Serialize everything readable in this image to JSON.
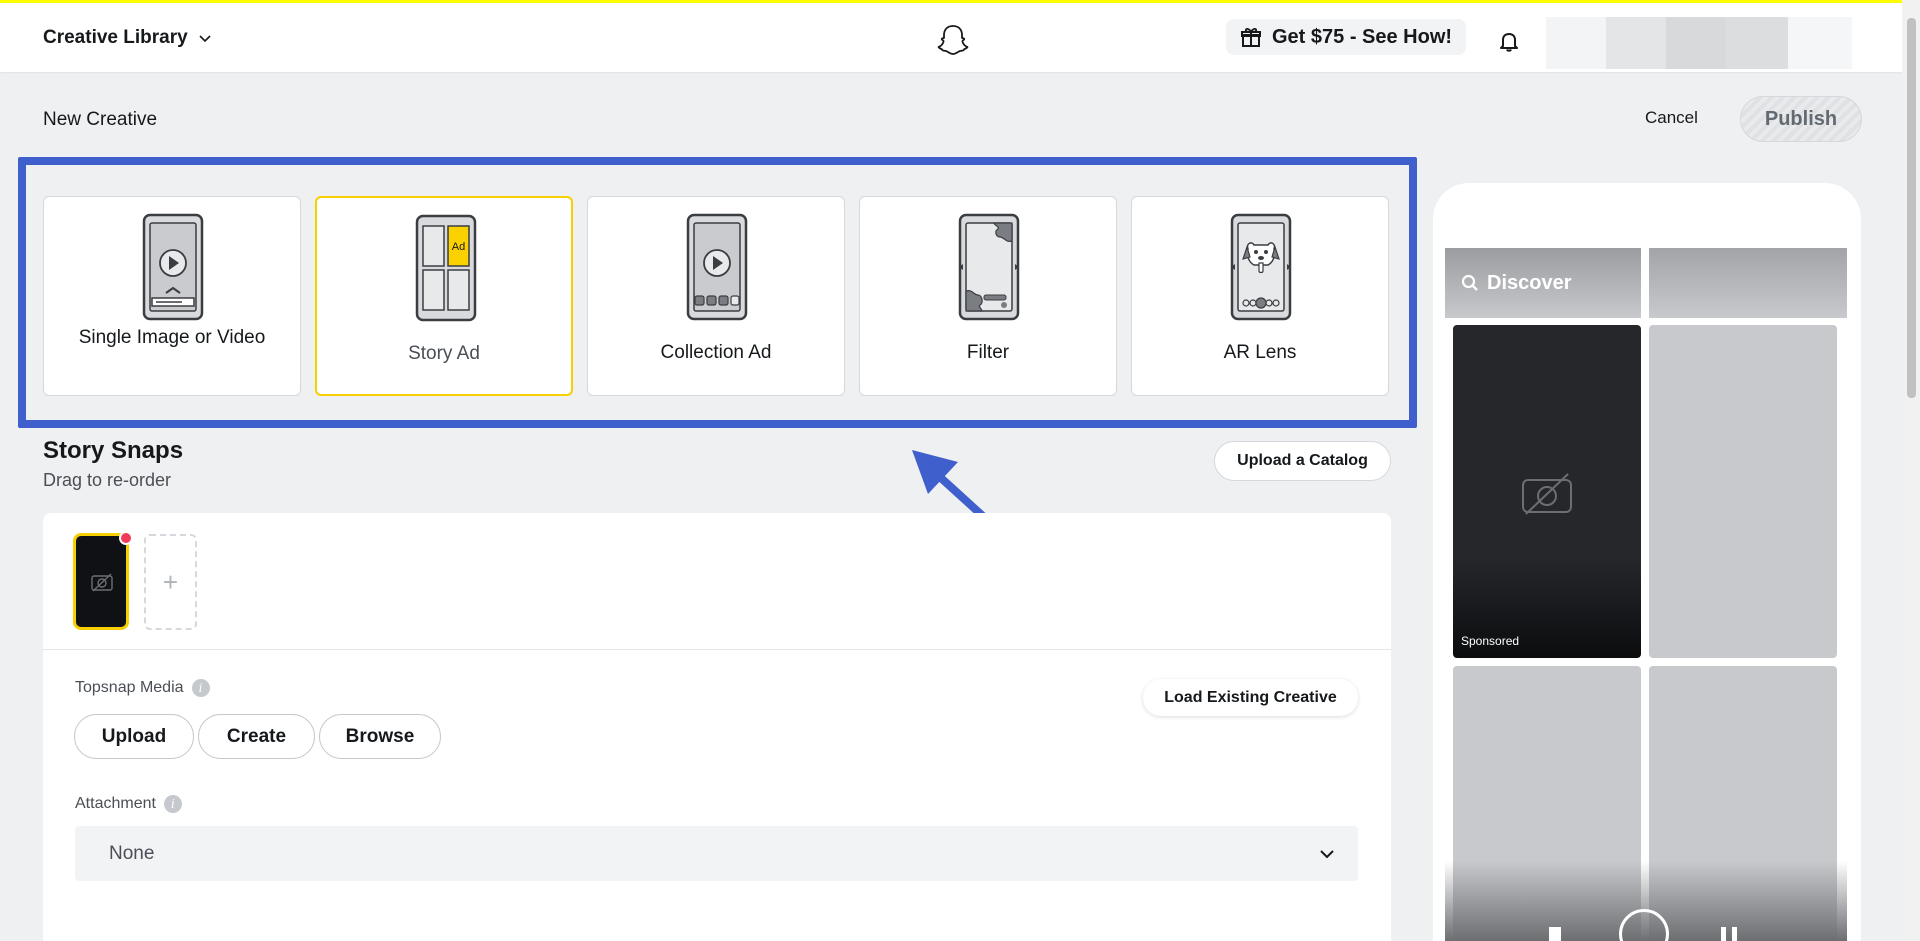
{
  "header": {
    "app_name": "Creative Library",
    "promo_label": "Get $75 - See How!"
  },
  "page": {
    "breadcrumb": "New Creative",
    "cancel_label": "Cancel",
    "publish_label": "Publish"
  },
  "creative_types": {
    "single": "Single Image or Video",
    "story": "Story Ad",
    "collection": "Collection Ad",
    "filter": "Filter",
    "lens": "AR Lens",
    "selected": "Story Ad",
    "ad_tag": "Ad"
  },
  "story_snaps": {
    "title": "Story Snaps",
    "subtitle": "Drag to re-order",
    "upload_catalog_label": "Upload a Catalog",
    "add_symbol": "+"
  },
  "topsnap": {
    "label": "Topsnap Media",
    "info_symbol": "i",
    "buttons": {
      "upload": "Upload",
      "create": "Create",
      "browse": "Browse"
    },
    "load_existing_label": "Load Existing Creative"
  },
  "attachment": {
    "label": "Attachment",
    "info_symbol": "i",
    "selected_value": "None"
  },
  "preview": {
    "discover_label": "Discover",
    "sponsored_label": "Sponsored"
  },
  "colors": {
    "accent_yellow": "#fffc00",
    "selected_border": "#f7d000",
    "annotation_blue": "#3f5fcd",
    "badge_red": "#f23c57"
  }
}
